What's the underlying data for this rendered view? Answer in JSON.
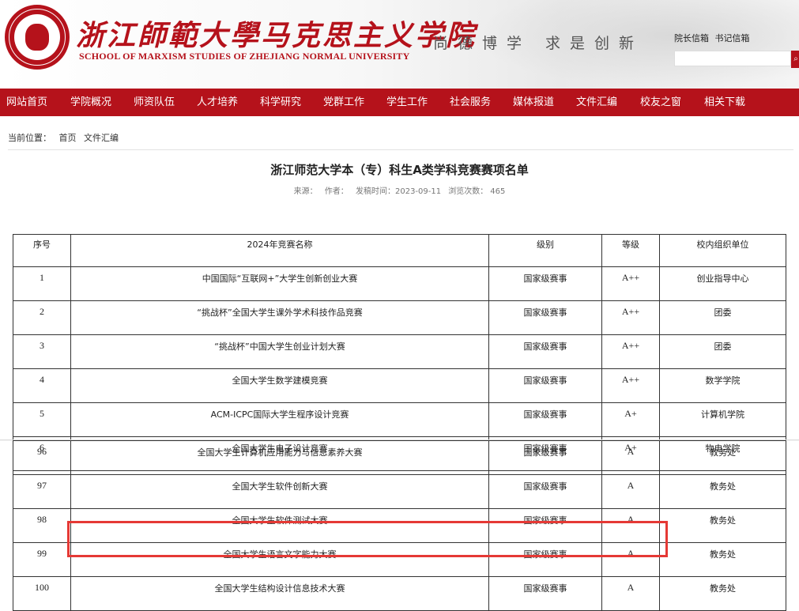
{
  "header": {
    "logo_alt": "School of Marxism Studies logo",
    "cn_title": "浙江師範大學马克思主义学院",
    "en_title": "SCHOOL OF MARXISM STUDIES OF ZHEJIANG NORMAL UNIVERSITY",
    "motto": "尚德博学 求是创新",
    "top_links": [
      "院长信箱",
      "书记信箱"
    ],
    "search_placeholder": "",
    "search_icon": "search-icon"
  },
  "nav": [
    "网站首页",
    "学院概况",
    "师资队伍",
    "人才培养",
    "科学研究",
    "党群工作",
    "学生工作",
    "社会服务",
    "媒体报道",
    "文件汇编",
    "校友之窗",
    "相关下载"
  ],
  "breadcrumb": {
    "label": "当前位置：",
    "items": [
      "首页",
      "文件汇编"
    ]
  },
  "article": {
    "title": "浙江师范大学本（专）科生A类学科竞赛赛项名单",
    "source_label": "来源：",
    "author_label": "作者：",
    "date_label": "发稿时间：2023-09-11",
    "views_label": "浏览次数：",
    "views": "465"
  },
  "table": {
    "headers": [
      "序号",
      "2024年竞赛名称",
      "级别",
      "等级",
      "校内组织单位"
    ],
    "rows_top": [
      [
        "1",
        "中国国际“互联网+”大学生创新创业大赛",
        "国家级赛事",
        "A++",
        "创业指导中心"
      ],
      [
        "2",
        "“挑战杯”全国大学生课外学术科技作品竞赛",
        "国家级赛事",
        "A++",
        "团委"
      ],
      [
        "3",
        "“挑战杯”中国大学生创业计划大赛",
        "国家级赛事",
        "A++",
        "团委"
      ],
      [
        "4",
        "全国大学生数学建模竞赛",
        "国家级赛事",
        "A++",
        "数学学院"
      ],
      [
        "5",
        "ACM-ICPC国际大学生程序设计竞赛",
        "国家级赛事",
        "A+",
        "计算机学院"
      ],
      [
        "6",
        "全国大学生电子设计竞赛",
        "国家级赛事",
        "A+",
        "物电学院"
      ]
    ],
    "rows_bottom": [
      [
        "96",
        "全国大学生计算机应用能力与信息素养大赛",
        "国家级赛事",
        "A",
        "教务处"
      ],
      [
        "97",
        "全国大学生软件创新大赛",
        "国家级赛事",
        "A",
        "教务处"
      ],
      [
        "98",
        "全国大学生软件测试大赛",
        "国家级赛事",
        "A",
        "教务处"
      ],
      [
        "99",
        "全国大学生语言文字能力大赛",
        "国家级赛事",
        "A",
        "教务处"
      ],
      [
        "100",
        "全国大学生结构设计信息技术大赛",
        "国家级赛事",
        "A",
        "教务处"
      ]
    ]
  },
  "colors": {
    "brand": "#b5121b",
    "highlight": "#e53935"
  }
}
